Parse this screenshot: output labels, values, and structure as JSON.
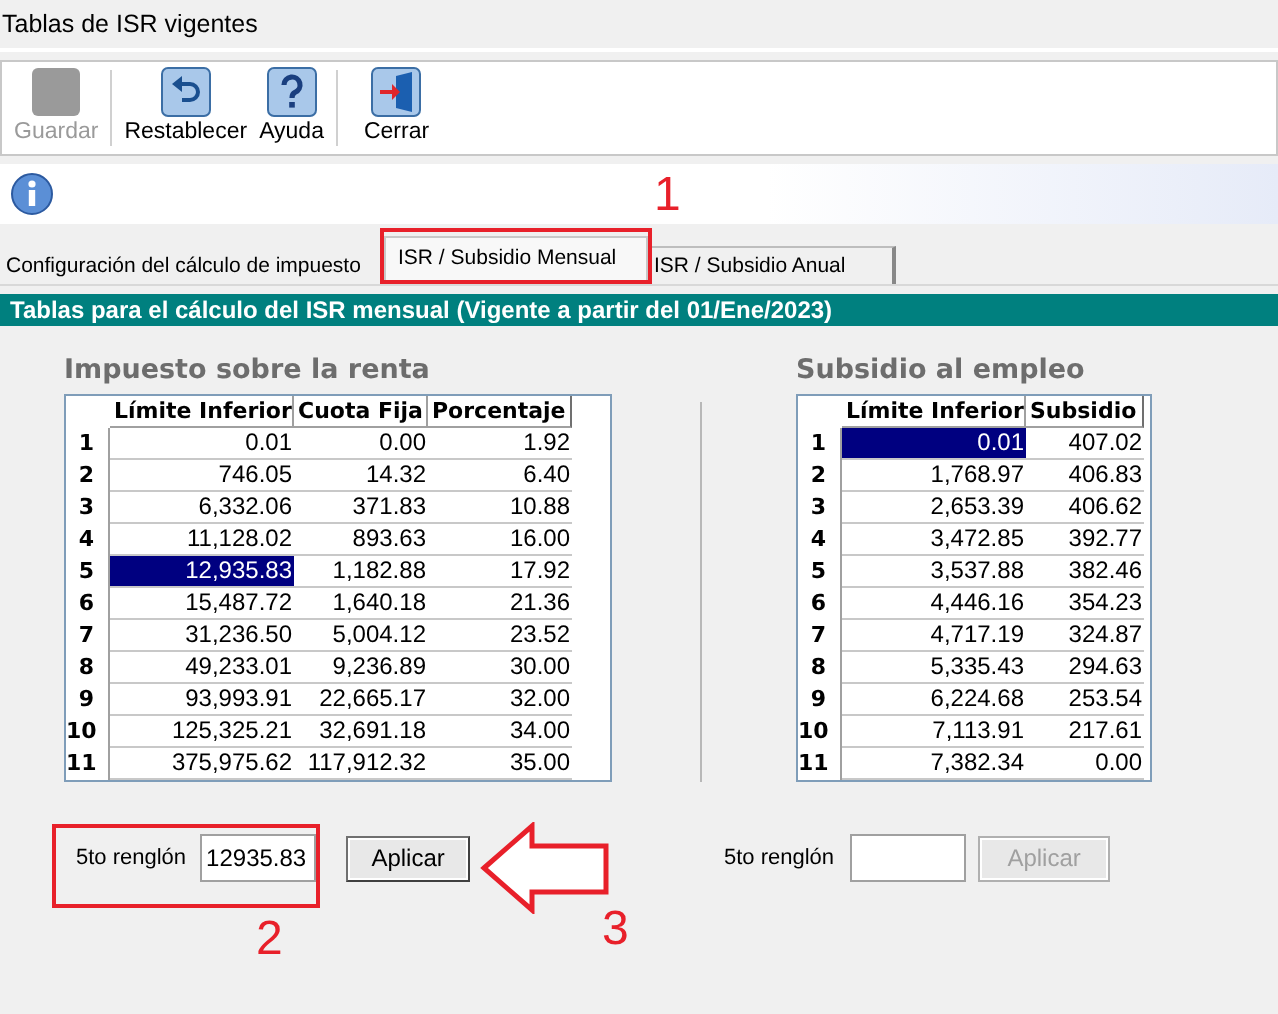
{
  "window": {
    "title": "Tablas de ISR vigentes"
  },
  "toolbar": [
    {
      "label": "Guardar",
      "kind": "blank",
      "disabled": true
    },
    {
      "label": "Restablecer",
      "kind": "undo",
      "disabled": false
    },
    {
      "label": "Ayuda",
      "kind": "help",
      "disabled": false
    },
    {
      "label": "Cerrar",
      "kind": "exit",
      "disabled": false
    }
  ],
  "tabs": [
    {
      "label": "Configuración del cálculo de impuesto",
      "selected": false
    },
    {
      "label": "ISR / Subsidio Mensual",
      "selected": true
    },
    {
      "label": "ISR / Subsidio Anual",
      "selected": false
    }
  ],
  "header": "Tablas para el cálculo del ISR mensual (Vigente a partir del 01/Ene/2023)",
  "panels": [
    {
      "title": "Impuesto sobre la renta",
      "columns": [
        "Límite Inferior",
        "Cuota Fija",
        "Porcentaje"
      ],
      "rows": [
        {
          "num": "1",
          "cells": [
            {
              "text": "0.01",
              "selected": false
            },
            {
              "text": "0.00",
              "selected": false
            },
            {
              "text": "1.92",
              "selected": false
            }
          ]
        },
        {
          "num": "2",
          "cells": [
            {
              "text": "746.05",
              "selected": false
            },
            {
              "text": "14.32",
              "selected": false
            },
            {
              "text": "6.40",
              "selected": false
            }
          ]
        },
        {
          "num": "3",
          "cells": [
            {
              "text": "6,332.06",
              "selected": false
            },
            {
              "text": "371.83",
              "selected": false
            },
            {
              "text": "10.88",
              "selected": false
            }
          ]
        },
        {
          "num": "4",
          "cells": [
            {
              "text": "11,128.02",
              "selected": false
            },
            {
              "text": "893.63",
              "selected": false
            },
            {
              "text": "16.00",
              "selected": false
            }
          ]
        },
        {
          "num": "5",
          "cells": [
            {
              "text": "12,935.83",
              "selected": true
            },
            {
              "text": "1,182.88",
              "selected": false
            },
            {
              "text": "17.92",
              "selected": false
            }
          ]
        },
        {
          "num": "6",
          "cells": [
            {
              "text": "15,487.72",
              "selected": false
            },
            {
              "text": "1,640.18",
              "selected": false
            },
            {
              "text": "21.36",
              "selected": false
            }
          ]
        },
        {
          "num": "7",
          "cells": [
            {
              "text": "31,236.50",
              "selected": false
            },
            {
              "text": "5,004.12",
              "selected": false
            },
            {
              "text": "23.52",
              "selected": false
            }
          ]
        },
        {
          "num": "8",
          "cells": [
            {
              "text": "49,233.01",
              "selected": false
            },
            {
              "text": "9,236.89",
              "selected": false
            },
            {
              "text": "30.00",
              "selected": false
            }
          ]
        },
        {
          "num": "9",
          "cells": [
            {
              "text": "93,993.91",
              "selected": false
            },
            {
              "text": "22,665.17",
              "selected": false
            },
            {
              "text": "32.00",
              "selected": false
            }
          ]
        },
        {
          "num": "10",
          "cells": [
            {
              "text": "125,325.21",
              "selected": false
            },
            {
              "text": "32,691.18",
              "selected": false
            },
            {
              "text": "34.00",
              "selected": false
            }
          ]
        },
        {
          "num": "11",
          "cells": [
            {
              "text": "375,975.62",
              "selected": false
            },
            {
              "text": "117,912.32",
              "selected": false
            },
            {
              "text": "35.00",
              "selected": false
            }
          ]
        }
      ],
      "row_label": "5to renglón",
      "value": "12935.83",
      "button": {
        "label": "Aplicar",
        "disabled": false
      }
    },
    {
      "title": "Subsidio al empleo",
      "columns": [
        "Límite Inferior",
        "Subsidio"
      ],
      "rows": [
        {
          "num": "1",
          "cells": [
            {
              "text": "0.01",
              "selected": true
            },
            {
              "text": "407.02",
              "selected": false
            }
          ]
        },
        {
          "num": "2",
          "cells": [
            {
              "text": "1,768.97",
              "selected": false
            },
            {
              "text": "406.83",
              "selected": false
            }
          ]
        },
        {
          "num": "3",
          "cells": [
            {
              "text": "2,653.39",
              "selected": false
            },
            {
              "text": "406.62",
              "selected": false
            }
          ]
        },
        {
          "num": "4",
          "cells": [
            {
              "text": "3,472.85",
              "selected": false
            },
            {
              "text": "392.77",
              "selected": false
            }
          ]
        },
        {
          "num": "5",
          "cells": [
            {
              "text": "3,537.88",
              "selected": false
            },
            {
              "text": "382.46",
              "selected": false
            }
          ]
        },
        {
          "num": "6",
          "cells": [
            {
              "text": "4,446.16",
              "selected": false
            },
            {
              "text": "354.23",
              "selected": false
            }
          ]
        },
        {
          "num": "7",
          "cells": [
            {
              "text": "4,717.19",
              "selected": false
            },
            {
              "text": "324.87",
              "selected": false
            }
          ]
        },
        {
          "num": "8",
          "cells": [
            {
              "text": "5,335.43",
              "selected": false
            },
            {
              "text": "294.63",
              "selected": false
            }
          ]
        },
        {
          "num": "9",
          "cells": [
            {
              "text": "6,224.68",
              "selected": false
            },
            {
              "text": "253.54",
              "selected": false
            }
          ]
        },
        {
          "num": "10",
          "cells": [
            {
              "text": "7,113.91",
              "selected": false
            },
            {
              "text": "217.61",
              "selected": false
            }
          ]
        },
        {
          "num": "11",
          "cells": [
            {
              "text": "7,382.34",
              "selected": false
            },
            {
              "text": "0.00",
              "selected": false
            }
          ]
        }
      ],
      "row_label": "5to renglón",
      "button": {
        "label": "Aplicar",
        "disabled": true
      }
    }
  ],
  "annotations": [
    "1",
    "2",
    "3"
  ]
}
